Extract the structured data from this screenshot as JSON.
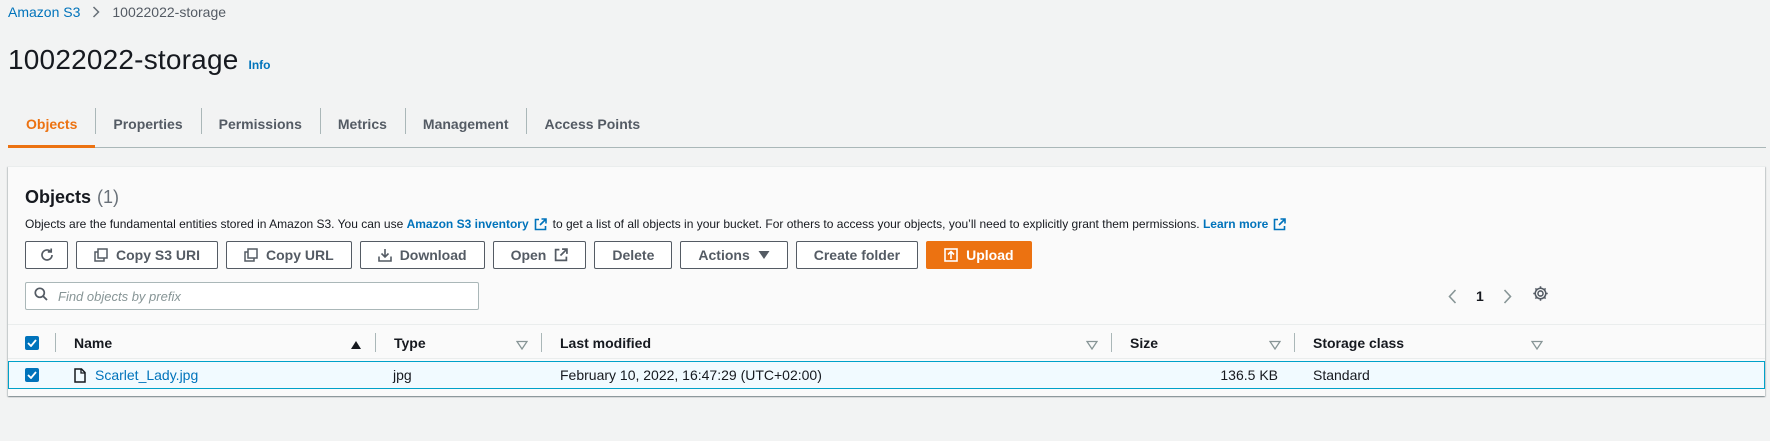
{
  "breadcrumb": {
    "root": "Amazon S3",
    "current": "10022022-storage"
  },
  "header": {
    "title": "10022022-storage",
    "info": "Info"
  },
  "tabs": [
    {
      "label": "Objects",
      "active": true
    },
    {
      "label": "Properties"
    },
    {
      "label": "Permissions"
    },
    {
      "label": "Metrics"
    },
    {
      "label": "Management"
    },
    {
      "label": "Access Points"
    }
  ],
  "objects": {
    "title": "Objects",
    "count": "(1)",
    "description": {
      "part1": "Objects are the fundamental entities stored in Amazon S3. You can use",
      "link1": "Amazon S3 inventory",
      "part2": "to get a list of all objects in your bucket. For others to access your objects, you’ll need to explicitly grant them permissions.",
      "link2": "Learn more"
    },
    "toolbar": {
      "copy_s3_uri": "Copy S3 URI",
      "copy_url": "Copy URL",
      "download": "Download",
      "open": "Open",
      "delete": "Delete",
      "actions": "Actions",
      "create_folder": "Create folder",
      "upload": "Upload"
    },
    "search": {
      "placeholder": "Find objects by prefix"
    },
    "pagination": {
      "page": "1"
    },
    "columns": {
      "name": "Name",
      "type": "Type",
      "last_modified": "Last modified",
      "size": "Size",
      "storage_class": "Storage class"
    },
    "rows": [
      {
        "name": "Scarlet_Lady.jpg",
        "type": "jpg",
        "last_modified": "February 10, 2022, 16:47:29 (UTC+02:00)",
        "size": "136.5 KB",
        "storage_class": "Standard",
        "selected": true
      }
    ]
  },
  "colors": {
    "accent": "#ec7211",
    "link": "#0073bb",
    "selected_row": "#f1faff",
    "selected_border": "#00a1c9"
  }
}
